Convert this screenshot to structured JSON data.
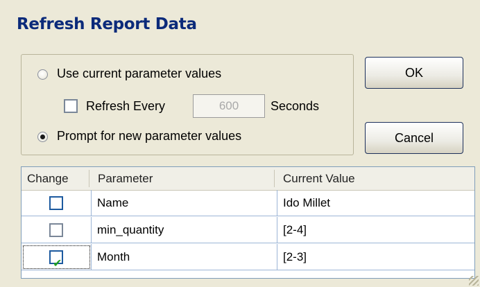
{
  "dialog": {
    "title": "Refresh Report Data"
  },
  "options": {
    "use_current_label": "Use current parameter values",
    "use_current_selected": false,
    "refresh_every_label": "Refresh Every",
    "refresh_every_checked": false,
    "refresh_seconds_value": "600",
    "seconds_label": "Seconds",
    "prompt_new_label": "Prompt for new parameter values",
    "prompt_new_selected": true
  },
  "buttons": {
    "ok_label": "OK",
    "cancel_label": "Cancel"
  },
  "table": {
    "headers": [
      "Change",
      "Parameter",
      "Current Value"
    ],
    "rows": [
      {
        "change": false,
        "parameter": "Name",
        "current_value": "Ido Millet"
      },
      {
        "change": false,
        "parameter": "min_quantity",
        "current_value": "[2-4]"
      },
      {
        "change": true,
        "parameter": "Month",
        "current_value": "[2-3]"
      }
    ]
  },
  "icons": [
    "radio-icon",
    "checkbox-icon",
    "checkmark-icon",
    "resize-grip-icon"
  ]
}
